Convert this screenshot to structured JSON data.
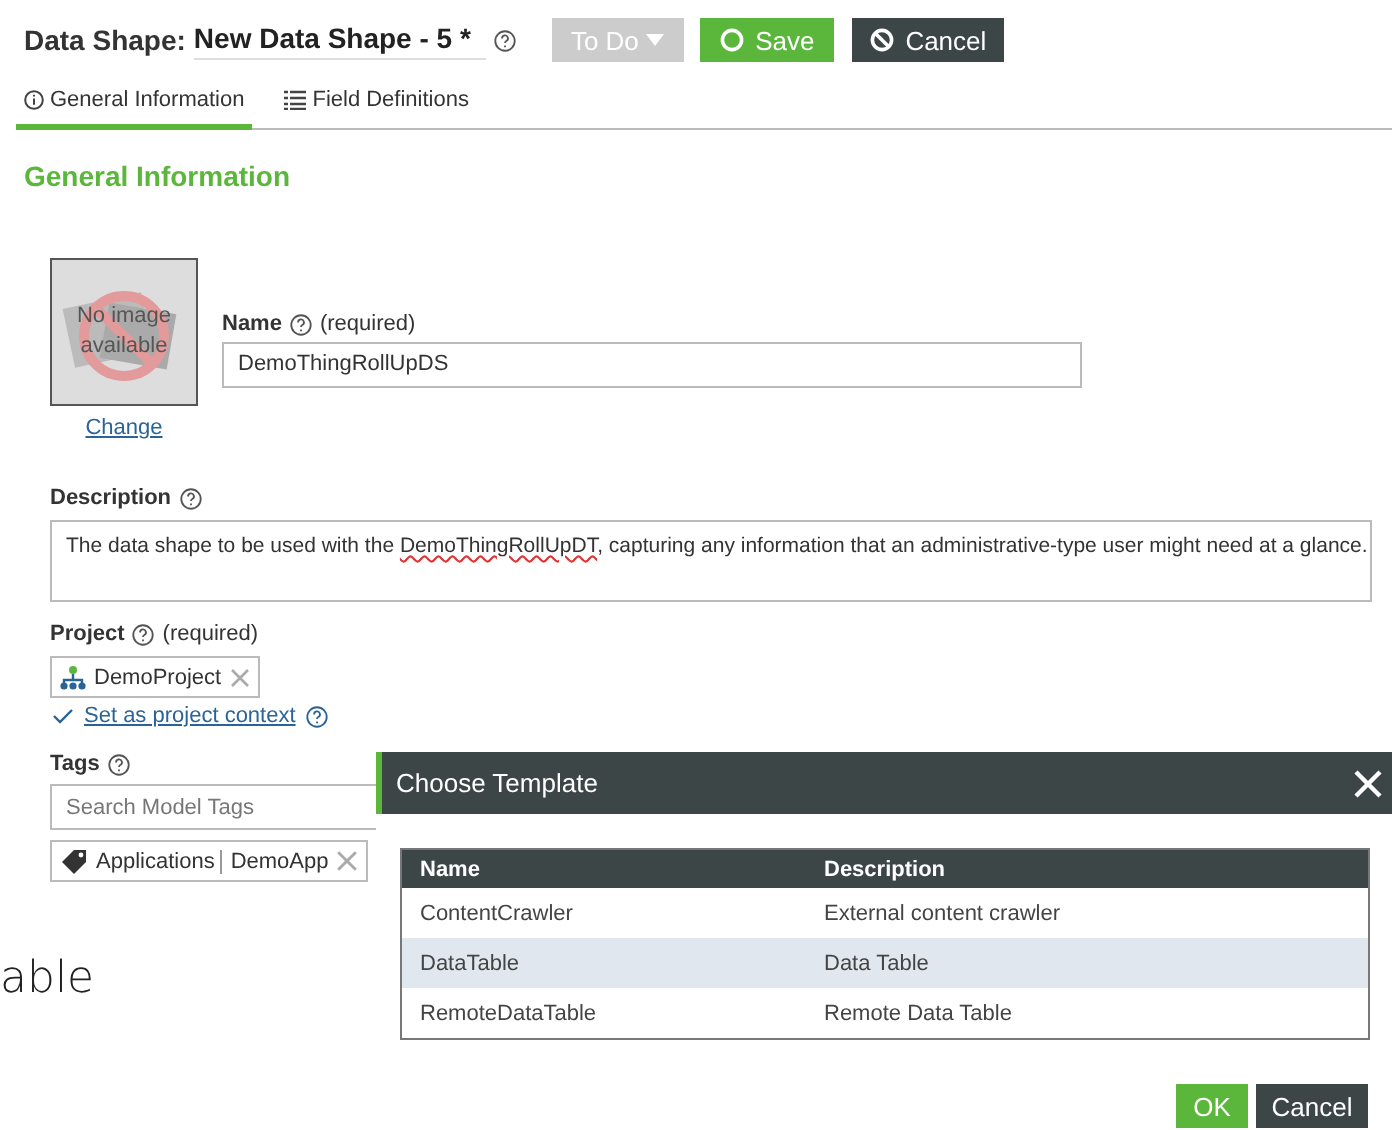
{
  "header": {
    "label": "Data Shape:",
    "title": "New Data Shape - 5 *",
    "state_button": "To Do",
    "save": "Save",
    "cancel": "Cancel"
  },
  "tabs": [
    {
      "label": "General Information",
      "selected": true
    },
    {
      "label": "Field Definitions",
      "selected": false
    }
  ],
  "section_title": "General Information",
  "image": {
    "placeholder": "No image available",
    "change": "Change"
  },
  "name": {
    "label": "Name",
    "required": "(required)",
    "value": "DemoThingRollUpDS"
  },
  "description": {
    "label": "Description",
    "before": "The data shape to be used with the ",
    "misspelled": "DemoThingRollUpDT",
    "after": ", capturing any information that an administrative-type user might need at a glance."
  },
  "project": {
    "label": "Project",
    "required": "(required)",
    "chip": "DemoProject",
    "context_link": "Set as project context"
  },
  "tags": {
    "label": "Tags",
    "placeholder": "Search Model Tags",
    "chip_vocabulary": "Applications",
    "chip_term": "DemoApp"
  },
  "background_text": "able",
  "dialog": {
    "title": "Choose Template",
    "columns": [
      "Name",
      "Description"
    ],
    "rows": [
      {
        "cells": [
          "ContentCrawler",
          "External content crawler"
        ],
        "selected": false
      },
      {
        "cells": [
          "DataTable",
          "Data Table"
        ],
        "selected": true
      },
      {
        "cells": [
          "RemoteDataTable",
          "Remote Data Table"
        ],
        "selected": false
      }
    ],
    "ok": "OK",
    "cancel": "Cancel"
  }
}
